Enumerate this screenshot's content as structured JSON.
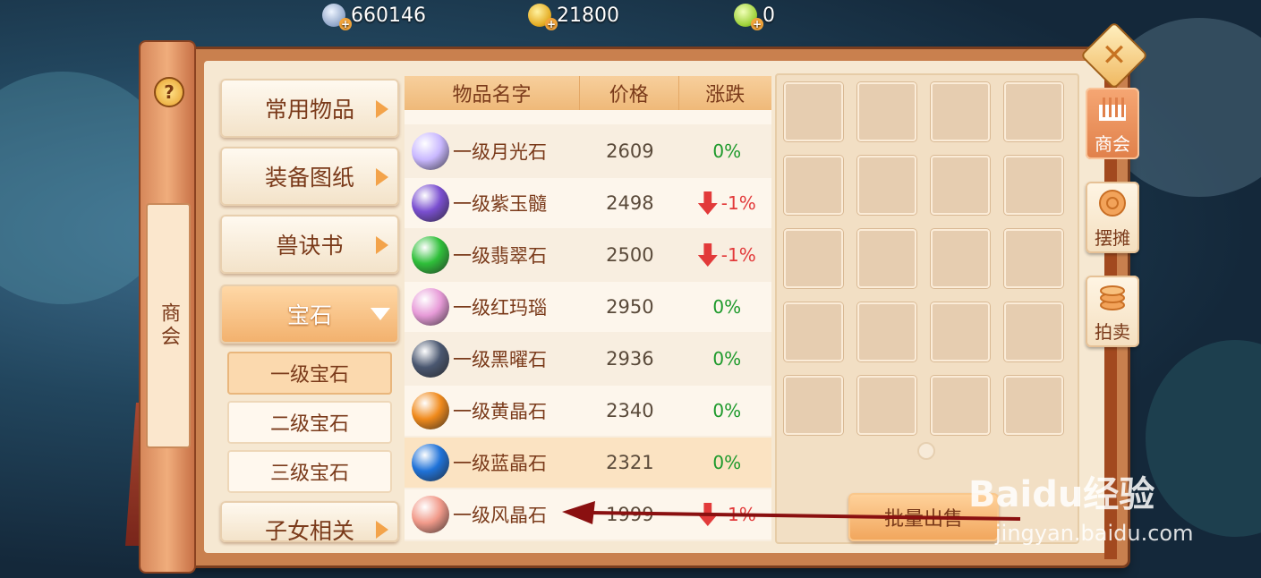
{
  "currencies": {
    "silver": "660146",
    "gold": "21800",
    "jade": "0"
  },
  "sidebar": {
    "help": "?",
    "title": "商会"
  },
  "categories": [
    {
      "label": "常用物品"
    },
    {
      "label": "装备图纸"
    },
    {
      "label": "兽诀书"
    },
    {
      "label": "宝石"
    },
    {
      "label": "子女相关"
    }
  ],
  "subcategories": [
    {
      "label": "一级宝石"
    },
    {
      "label": "二级宝石"
    },
    {
      "label": "三级宝石"
    }
  ],
  "table": {
    "headers": {
      "name": "物品名字",
      "price": "价格",
      "change": "涨跌"
    },
    "rows": [
      {
        "name": "一级月光石",
        "price": "2609",
        "change": "0%",
        "trend": "flat",
        "color": "#c9b8ff"
      },
      {
        "name": "一级紫玉髓",
        "price": "2498",
        "change": "-1%",
        "trend": "down",
        "color": "#7a4fd0"
      },
      {
        "name": "一级翡翠石",
        "price": "2500",
        "change": "-1%",
        "trend": "down",
        "color": "#2fbf3a"
      },
      {
        "name": "一级红玛瑙",
        "price": "2950",
        "change": "0%",
        "trend": "flat",
        "color": "#e79bd8"
      },
      {
        "name": "一级黑曜石",
        "price": "2936",
        "change": "0%",
        "trend": "flat",
        "color": "#4a5770"
      },
      {
        "name": "一级黄晶石",
        "price": "2340",
        "change": "0%",
        "trend": "flat",
        "color": "#f08a1c"
      },
      {
        "name": "一级蓝晶石",
        "price": "2321",
        "change": "0%",
        "trend": "flat",
        "color": "#1f72d8"
      },
      {
        "name": "一级风晶石",
        "price": "1999",
        "change": "-1%",
        "trend": "down",
        "color": "#f19a8a"
      }
    ]
  },
  "actions": {
    "sell_all": "批量出售"
  },
  "right_tabs": [
    {
      "label": "商会"
    },
    {
      "label": "摆摊"
    },
    {
      "label": "拍卖"
    }
  ],
  "watermark": {
    "brand": "Baidu经验",
    "url": "jingyan.baidu.com"
  },
  "colors": {
    "accent": "#f2b06c",
    "up": "#1e9a2c",
    "down": "#e2393a",
    "annotation_arrow": "#8a1010"
  }
}
